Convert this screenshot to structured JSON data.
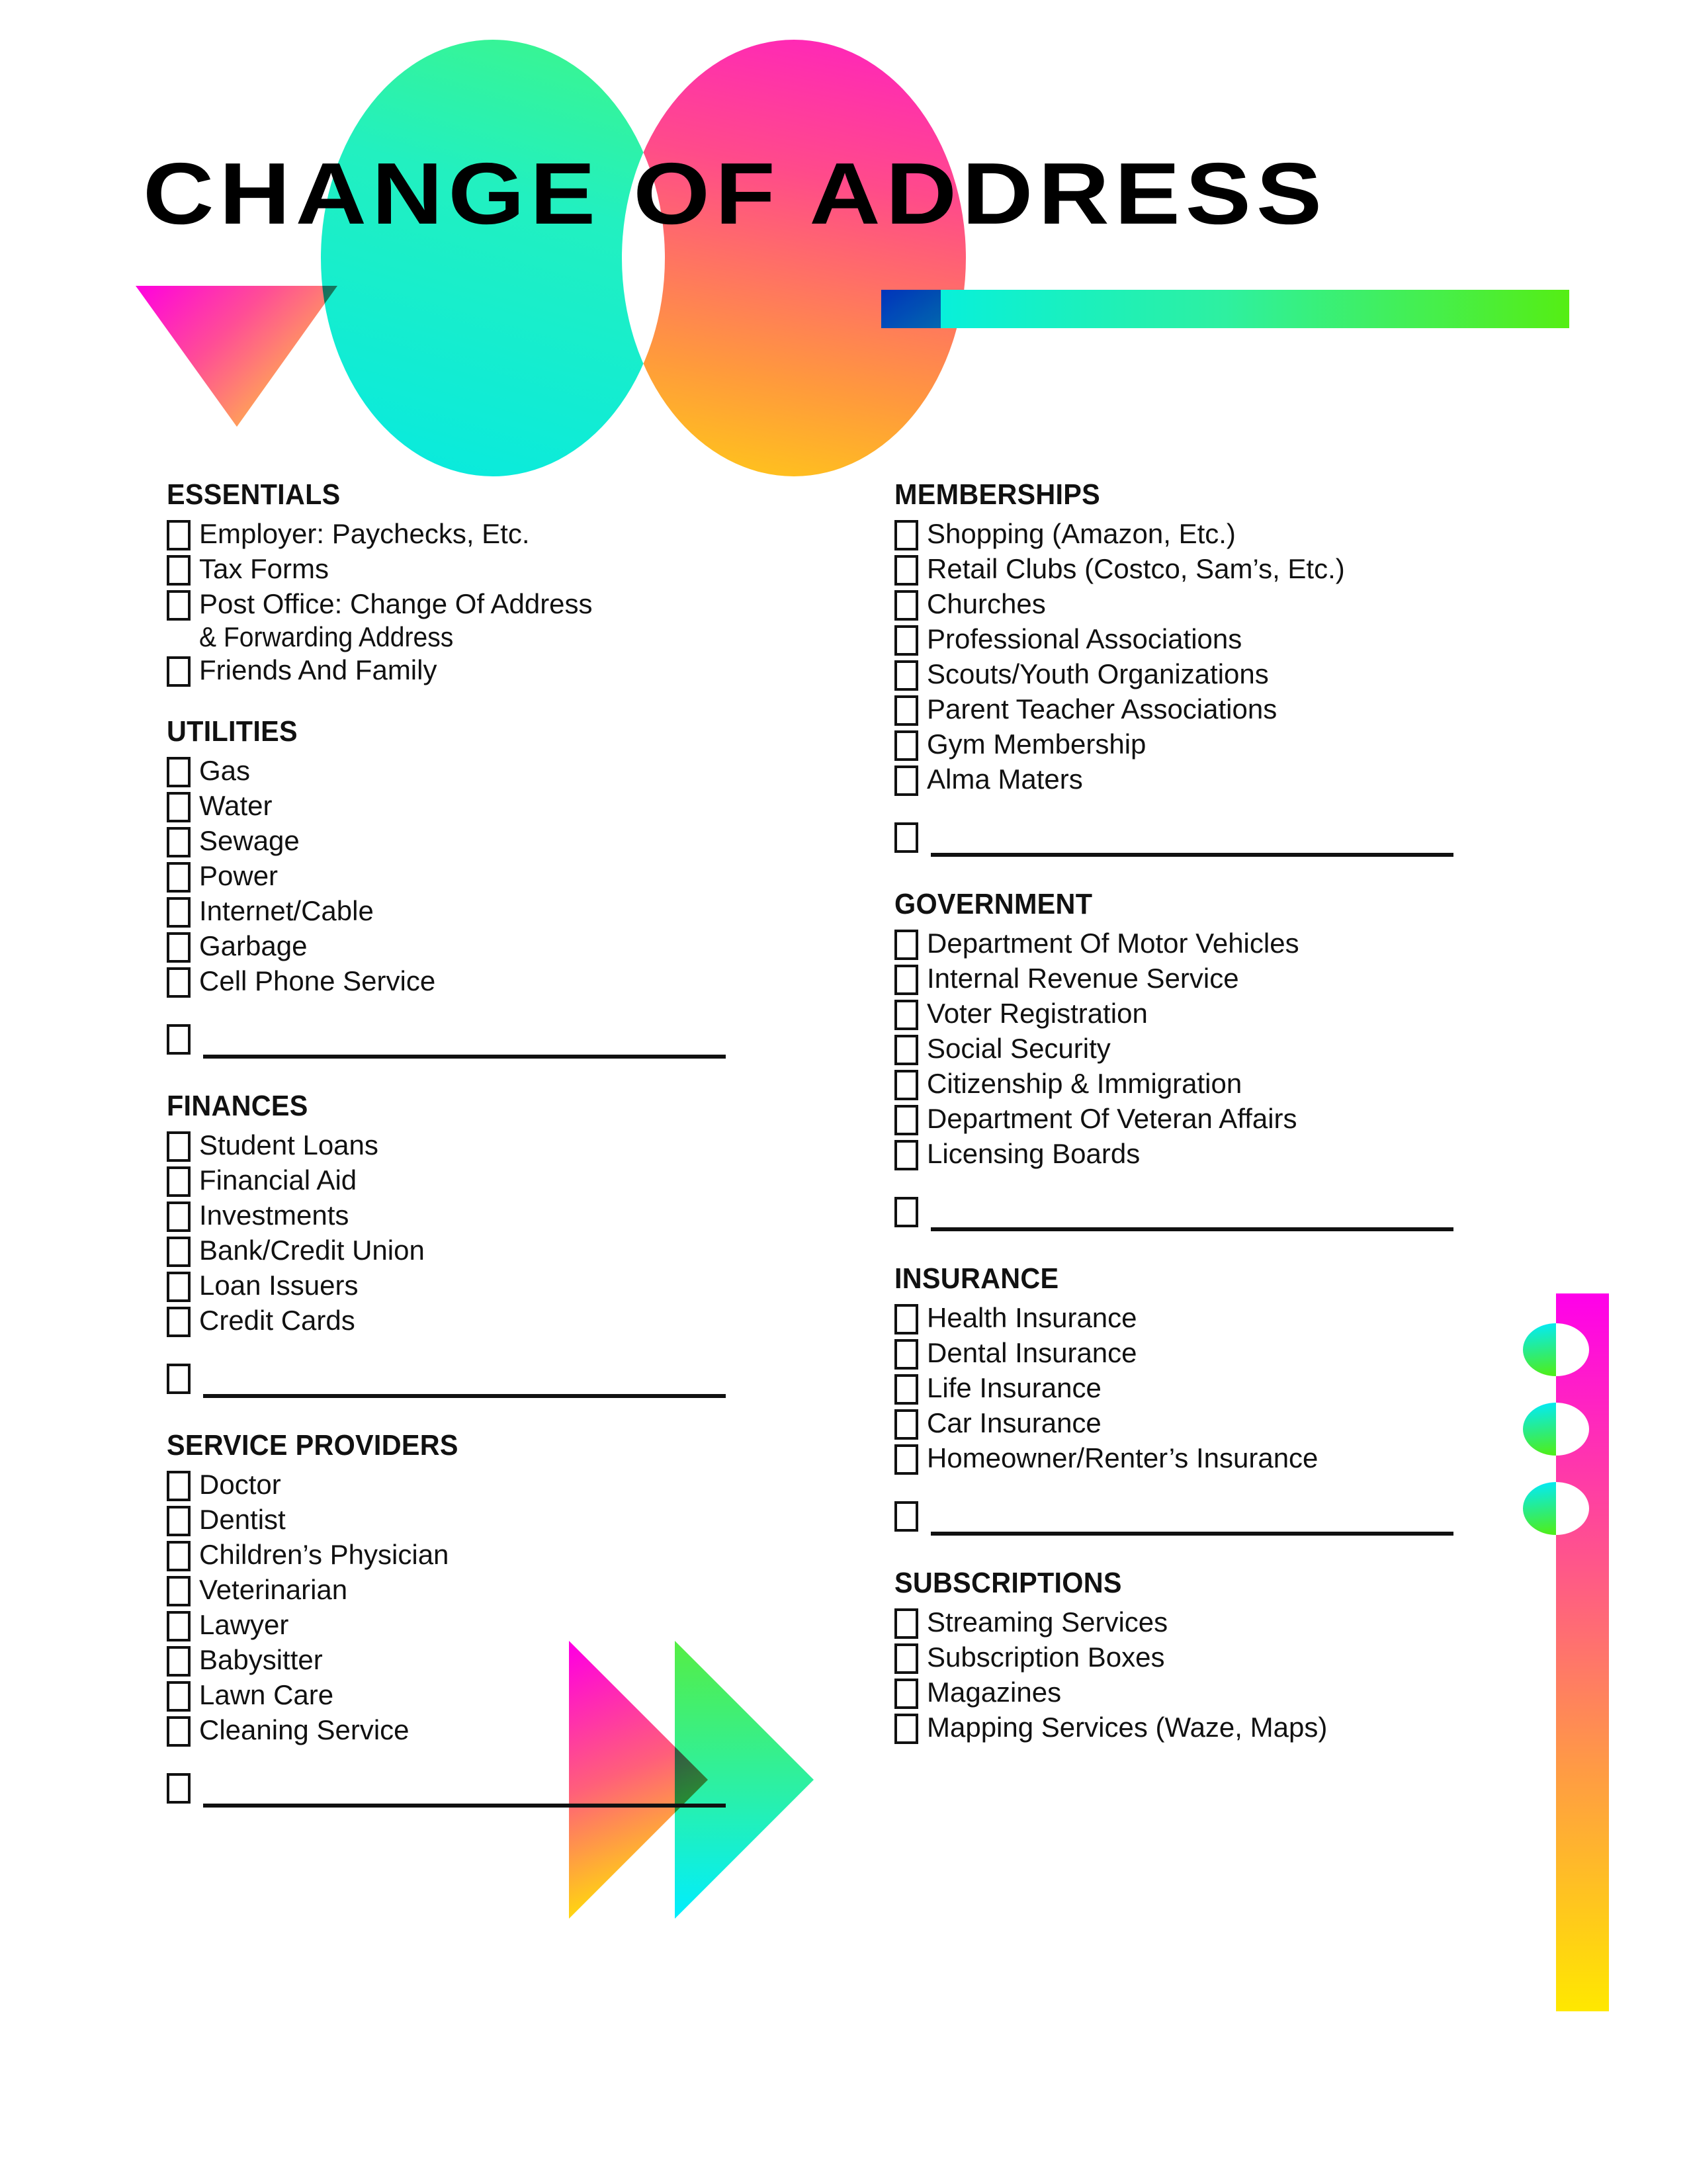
{
  "document": {
    "title": "CHANGE OF ADDRESS",
    "title_words": [
      "CHANGE",
      "OF",
      "ADDRESS"
    ]
  },
  "decor": {
    "circle_left": {
      "name": "green-circle",
      "from": "#00f0e0",
      "to": "#66ff33"
    },
    "circle_right": {
      "name": "pink-circle",
      "from": "#ff00e6",
      "to": "#ffe400"
    },
    "triangle_down": {
      "name": "magenta-triangle",
      "from": "#ff00e0",
      "to": "#ffc83c"
    },
    "bar_horizontal": {
      "name": "cyan-green-bar",
      "from": "#00f5e0",
      "to": "#55ee22"
    },
    "square_blue": {
      "name": "blue-square",
      "from": "#1a3fd0",
      "to": "#0a66c8"
    },
    "arrow_pink": {
      "name": "pink-arrow",
      "from": "#ff00e0",
      "to": "#ffe800"
    },
    "arrow_green": {
      "name": "green-arrow",
      "from": "#44ee55",
      "to": "#00f0f0"
    },
    "bar_vertical": {
      "name": "magenta-yellow-bar",
      "stops": [
        "#ff00ea",
        "#ff3b9e",
        "#ff8a4c",
        "#ffe800"
      ]
    },
    "dots": {
      "name": "half-circles",
      "from": "#00eaff",
      "to": "#55ee22",
      "count": 3
    }
  },
  "columns": {
    "left": [
      {
        "id": "essentials",
        "heading": "ESSENTIALS",
        "items": [
          {
            "label": "Employer: Paychecks, Etc."
          },
          {
            "label": "Tax Forms"
          },
          {
            "label": "Post Office: Change Of Address",
            "continuation": "& Forwarding Address"
          },
          {
            "label": "Friends And Family"
          }
        ],
        "blank_lines": 0
      },
      {
        "id": "utilities",
        "heading": "UTILITIES",
        "items": [
          {
            "label": "Gas"
          },
          {
            "label": "Water"
          },
          {
            "label": "Sewage"
          },
          {
            "label": "Power"
          },
          {
            "label": "Internet/Cable"
          },
          {
            "label": "Garbage"
          },
          {
            "label": "Cell Phone Service"
          }
        ],
        "blank_lines": 1
      },
      {
        "id": "finances",
        "heading": "FINANCES",
        "items": [
          {
            "label": "Student Loans"
          },
          {
            "label": "Financial Aid"
          },
          {
            "label": "Investments"
          },
          {
            "label": "Bank/Credit Union"
          },
          {
            "label": "Loan Issuers"
          },
          {
            "label": "Credit Cards"
          }
        ],
        "blank_lines": 1
      },
      {
        "id": "service-providers",
        "heading": "SERVICE PROVIDERS",
        "items": [
          {
            "label": "Doctor"
          },
          {
            "label": "Dentist"
          },
          {
            "label": "Children’s Physician"
          },
          {
            "label": "Veterinarian"
          },
          {
            "label": "Lawyer"
          },
          {
            "label": "Babysitter"
          },
          {
            "label": "Lawn Care"
          },
          {
            "label": "Cleaning Service"
          }
        ],
        "blank_lines": 1
      }
    ],
    "right": [
      {
        "id": "memberships",
        "heading": "MEMBERSHIPS",
        "items": [
          {
            "label": "Shopping (Amazon, Etc.)"
          },
          {
            "label": "Retail Clubs (Costco, Sam’s, Etc.)"
          },
          {
            "label": "Churches"
          },
          {
            "label": "Professional Associations"
          },
          {
            "label": "Scouts/Youth Organizations"
          },
          {
            "label": "Parent Teacher Associations"
          },
          {
            "label": "Gym Membership"
          },
          {
            "label": "Alma Maters"
          }
        ],
        "blank_lines": 1
      },
      {
        "id": "government",
        "heading": "GOVERNMENT",
        "items": [
          {
            "label": "Department Of Motor Vehicles"
          },
          {
            "label": "Internal Revenue Service"
          },
          {
            "label": "Voter Registration"
          },
          {
            "label": "Social Security"
          },
          {
            "label": "Citizenship & Immigration"
          },
          {
            "label": "Department Of Veteran Affairs"
          },
          {
            "label": "Licensing Boards"
          }
        ],
        "blank_lines": 1
      },
      {
        "id": "insurance",
        "heading": "INSURANCE",
        "items": [
          {
            "label": "Health Insurance"
          },
          {
            "label": "Dental Insurance"
          },
          {
            "label": "Life Insurance"
          },
          {
            "label": "Car Insurance"
          },
          {
            "label": "Homeowner/Renter’s Insurance"
          }
        ],
        "blank_lines": 1
      },
      {
        "id": "subscriptions",
        "heading": "SUBSCRIPTIONS",
        "items": [
          {
            "label": "Streaming Services"
          },
          {
            "label": "Subscription Boxes"
          },
          {
            "label": "Magazines"
          },
          {
            "label": "Mapping Services (Waze, Maps)"
          }
        ],
        "blank_lines": 0
      }
    ]
  }
}
